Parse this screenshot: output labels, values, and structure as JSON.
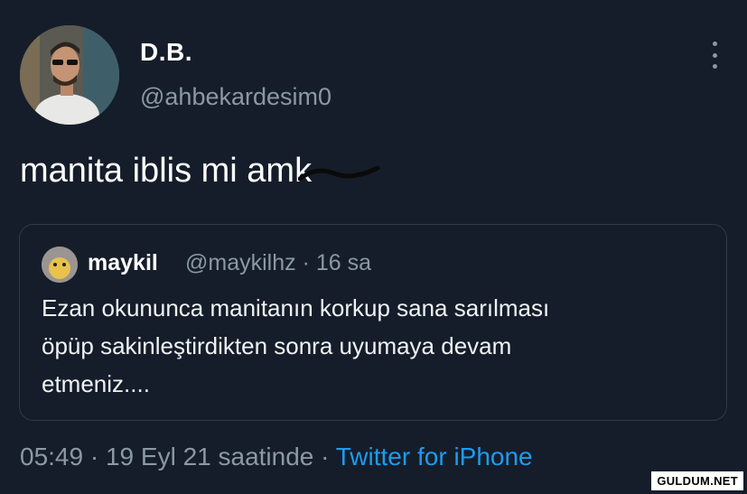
{
  "author": {
    "name": "D.B.",
    "handle": "@ahbekardesim0"
  },
  "tweet": {
    "text": "manita iblis mi amk"
  },
  "quoted": {
    "name": "maykil",
    "handle": "@maykilhz",
    "time": "16 sa",
    "separator": "·",
    "text_lines": [
      "Ezan okununca manitanın korkup sana sarılması",
      "öpüp sakinleştirdikten sonra uyumaya devam",
      "etmeniz...."
    ]
  },
  "footer": {
    "time": "05:49",
    "separator": "·",
    "date": "19 Eyl 21 saatinde",
    "source": "Twitter for iPhone"
  },
  "watermark": "GULDUM.NET",
  "icons": {
    "more": "more-vertical-icon"
  },
  "colors": {
    "background": "#151d2a",
    "secondary_text": "#8b98a5",
    "link": "#1d9bf0"
  }
}
